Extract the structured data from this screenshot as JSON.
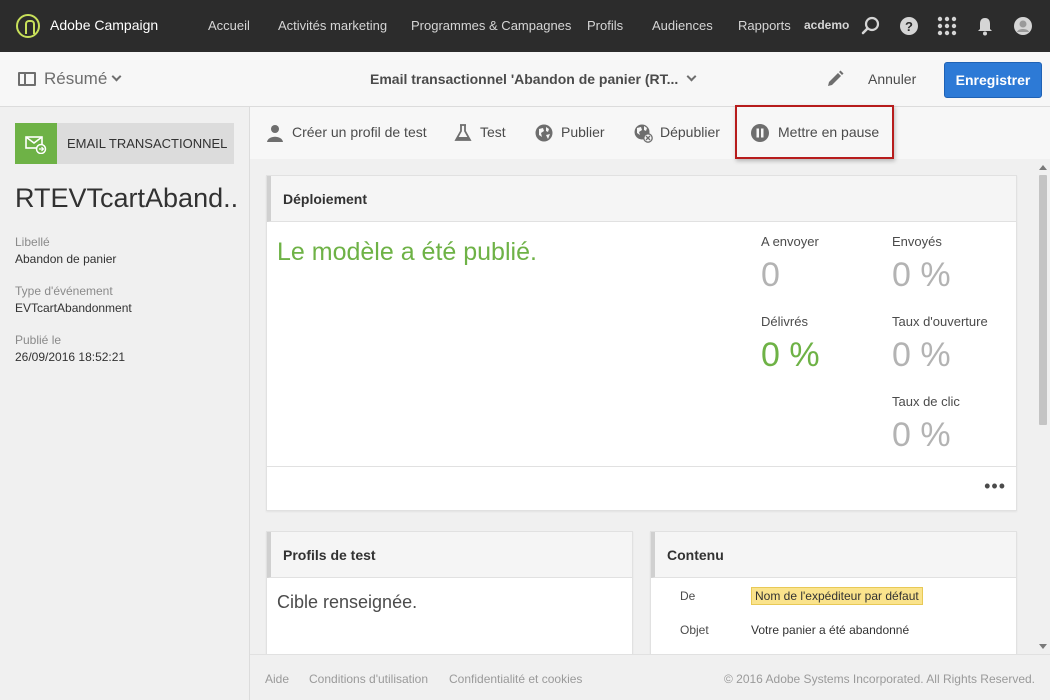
{
  "colors": {
    "topbar": "#2c2c2c",
    "accent_blue": "#2d7ad6",
    "success_green": "#6eb246",
    "highlight_red": "#b71c1c",
    "tag_yellow": "#fae38c"
  },
  "topbar": {
    "brand": "Adobe Campaign",
    "nav": [
      "Accueil",
      "Activités marketing",
      "Programmes & Campagnes",
      "Profils",
      "Audiences",
      "Rapports"
    ],
    "user": "acdemo",
    "icons": [
      "search-icon",
      "help-icon",
      "apps-grid-icon",
      "bell-icon",
      "user-avatar-icon"
    ]
  },
  "header": {
    "summary_label": "Résumé",
    "title": "Email transactionnel 'Abandon de panier (RT...",
    "cancel_label": "Annuler",
    "save_label": "Enregistrer"
  },
  "left_panel": {
    "type_label": "EMAIL TRANSACTIONNEL",
    "title": "RTEVTcartAband...",
    "props": [
      {
        "label": "Libellé",
        "value": "Abandon de panier"
      },
      {
        "label": "Type d'événement",
        "value": "EVTcartAbandonment"
      },
      {
        "label": "Publié le",
        "value": "26/09/2016 18:52:21"
      }
    ]
  },
  "toolbar": {
    "create_test_profile": "Créer un profil de test",
    "test": "Test",
    "publish": "Publier",
    "unpublish": "Dépublier",
    "pause": "Mettre en pause"
  },
  "deployment": {
    "title": "Déploiement",
    "message": "Le modèle a été publié.",
    "stats": {
      "to_send_label": "A envoyer",
      "to_send_value": "0",
      "sent_label": "Envoyés",
      "sent_value": "0 %",
      "delivered_label": "Délivrés",
      "delivered_value": "0 %",
      "open_rate_label": "Taux d'ouverture",
      "open_rate_value": "0 %",
      "click_rate_label": "Taux de clic",
      "click_rate_value": "0 %"
    },
    "more": "•••"
  },
  "test_profiles": {
    "title": "Profils de test",
    "message": "Cible renseignée."
  },
  "content_card": {
    "title": "Contenu",
    "from_label": "De",
    "from_value": "Nom de l'expéditeur par défaut",
    "subject_label": "Objet",
    "subject_value": "Votre panier a été abandonné"
  },
  "footer": {
    "help": "Aide",
    "terms": "Conditions d'utilisation",
    "privacy": "Confidentialité et cookies",
    "copyright": "© 2016 Adobe Systems Incorporated. All Rights Reserved."
  }
}
